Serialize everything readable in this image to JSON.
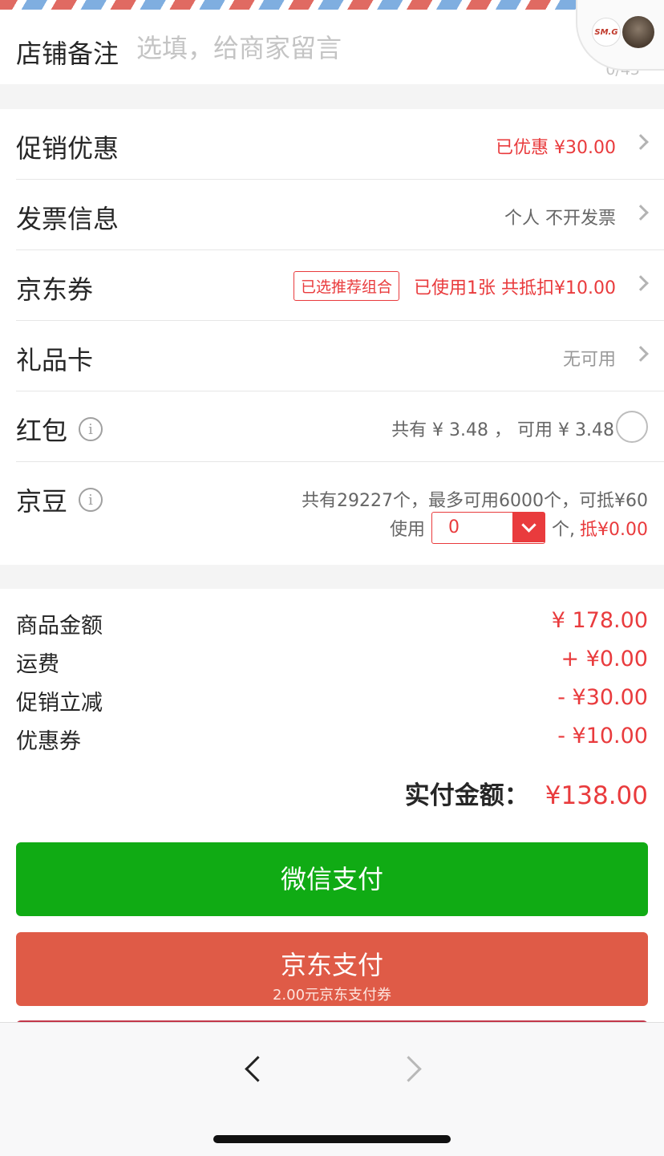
{
  "store_note": {
    "label": "店铺备注",
    "placeholder": "选填，给商家留言",
    "value": "",
    "counter": "0/45"
  },
  "float_widget": {
    "logo_text": "SM.G"
  },
  "options": {
    "promotion": {
      "label": "促销优惠",
      "value": "已优惠 ¥30.00"
    },
    "invoice": {
      "label": "发票信息",
      "value": "个人 不开发票"
    },
    "jd_coupon": {
      "label": "京东券",
      "tag": "已选推荐组合",
      "value": "已使用1张 共抵扣¥10.00"
    },
    "gift_card": {
      "label": "礼品卡",
      "value": "无可用"
    },
    "red_packet": {
      "label": "红包",
      "info_glyph": "i",
      "value": "共有 ¥ 3.48 ， 可用 ¥ 3.48"
    },
    "beans": {
      "label": "京豆",
      "info_glyph": "i",
      "summary": "共有29227个，最多可用6000个，可抵¥60",
      "use_label": "使用",
      "selected": "0",
      "unit": "个,",
      "deduct": "抵¥0.00"
    }
  },
  "summary": {
    "rows": [
      {
        "label": "商品金额",
        "value": "¥ 178.00"
      },
      {
        "label": "运费",
        "value": "+ ¥0.00"
      },
      {
        "label": "促销立减",
        "value": "- ¥30.00"
      },
      {
        "label": "优惠券",
        "value": "- ¥10.00"
      }
    ],
    "total_label": "实付金额：",
    "total_value": "¥138.00"
  },
  "payment": {
    "wechat": {
      "label": "微信支付"
    },
    "jd": {
      "label": "京东支付",
      "sub": "2.00元京东支付券"
    }
  },
  "colors": {
    "accent_red": "#e93b3d",
    "wechat_green": "#10ab14",
    "jd_pay": "#df5b47"
  }
}
